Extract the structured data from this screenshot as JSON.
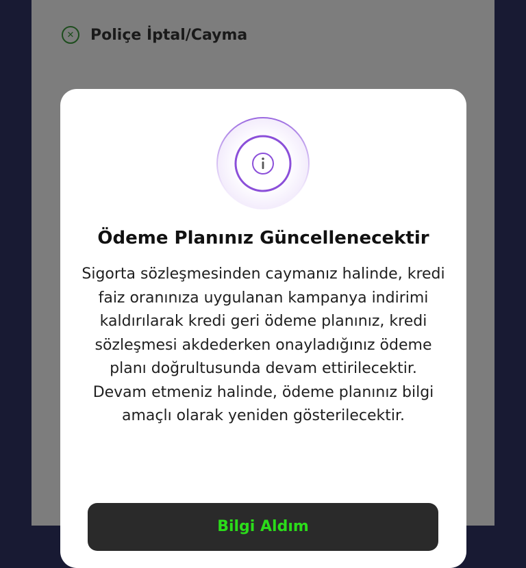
{
  "background_row": {
    "icon": "x-circle-icon",
    "label": "Poliçe İptal/Cayma"
  },
  "modal": {
    "icon": "info-icon",
    "title": "Ödeme Planınız Güncellenecektir",
    "body": "Sigorta sözleşmesinden caymanız halinde, kredi faiz oranınıza uygulanan kampanya indirimi kaldırılarak kredi geri ödeme planınız, kredi sözleşmesi akdederken onayladığınız ödeme planı doğrultusunda devam ettirilecektir. Devam etmeniz halinde, ödeme planınız bilgi amaçlı olarak yeniden gösterilecektir.",
    "primary_button": "Bilgi Aldım"
  },
  "colors": {
    "accent_purple": "#8b4fd9",
    "button_text_green": "#2bdc1a",
    "overlay_gray": "#7d7d7d",
    "outer_navy": "#181a33"
  }
}
